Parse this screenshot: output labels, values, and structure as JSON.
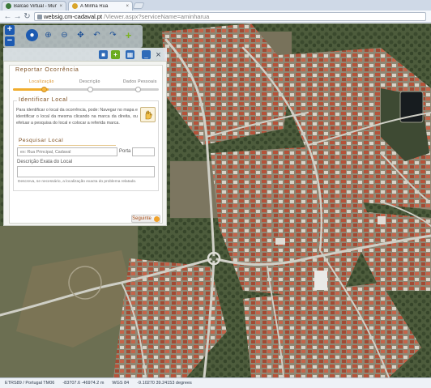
{
  "browser": {
    "tabs": [
      {
        "title": "Balcão Virtual - Município",
        "favicon_color": "#3b7a3b",
        "active": false
      },
      {
        "title": "A Minha Rua",
        "favicon_color": "#d9a52b",
        "active": true
      }
    ],
    "close_glyph": "×",
    "address": {
      "host": "websig.cm-cadaval.pt",
      "path": "/Viewer.aspx?serviceName=aminharua"
    },
    "back_icon": "arrow-left-icon",
    "forward_icon": "arrow-right-icon",
    "reload_icon": "reload-icon"
  },
  "map_toolbar": {
    "zoom_in": "+",
    "zoom_out": "−",
    "tools": [
      "globe-icon",
      "zoom-in-icon",
      "zoom-out-icon",
      "pan-icon",
      "back-extent-icon",
      "forward-extent-icon",
      "expand-icon",
      "add-report-icon"
    ]
  },
  "panel_header_icons": [
    "save-icon",
    "add-icon",
    "layers-icon",
    "minimize-icon",
    "close-icon"
  ],
  "report": {
    "title": "Reportar Ocorrência",
    "steps": [
      {
        "label": "Localização",
        "active": true
      },
      {
        "label": "Descrição",
        "active": false
      },
      {
        "label": "Dados Pessoais",
        "active": false
      }
    ],
    "locate": {
      "title": "Identificar Local",
      "description": "Para identificar o local da ocorrência, pode: Navegar no mapa e identificar o local da mesma clicando na marca da direita, ou efetuar a pesquisa do local e colocar a referida marca."
    },
    "search": {
      "title": "Pesquisar Local",
      "street_placeholder": "ex: Rua Principal, Cadaval",
      "door_label": "Porta",
      "door_value": "",
      "exact_desc_label": "Descrição Exata do Local",
      "exact_desc_value": "",
      "hint": "Descreva, se necessário, a localização exacta do problema relatado."
    },
    "next_label": "Seguinte"
  },
  "status_bar": {
    "crs": "ETRS89 / Portugal TM06",
    "coords": "-83707.6  -46974.2 m",
    "wgs": "WGS 84",
    "geo": "-9.10270  39.24153 degrees"
  },
  "colors": {
    "accent_orange": "#f0ad2e",
    "title_brown": "#7a4c1e",
    "tool_blue": "#1c5ab1"
  }
}
